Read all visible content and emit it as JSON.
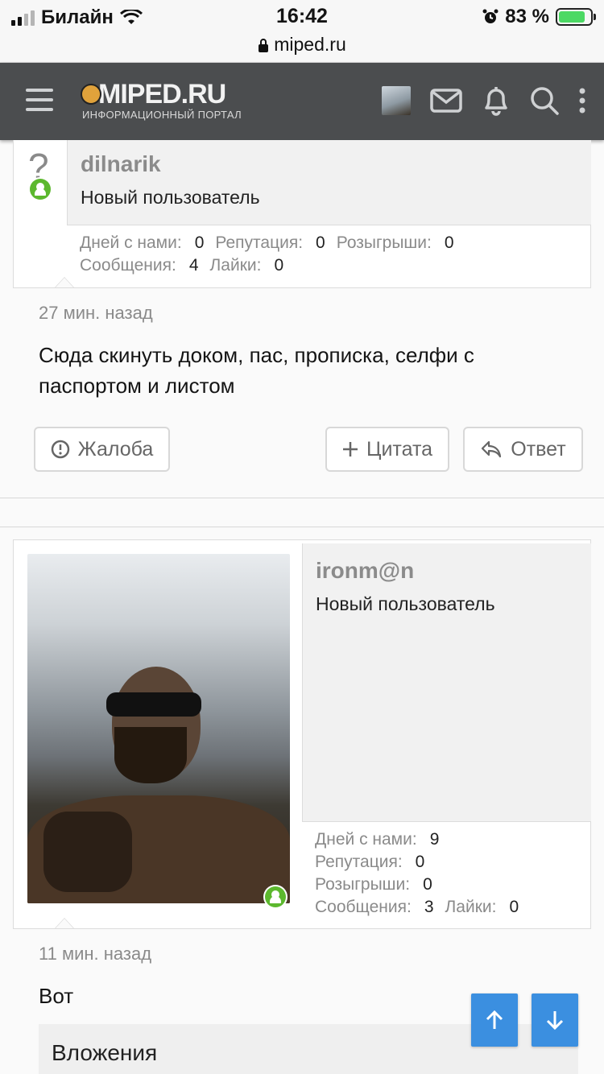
{
  "status_bar": {
    "carrier": "Билайн",
    "time": "16:42",
    "url": "miped.ru",
    "battery": "83 %",
    "battery_level": 0.83
  },
  "header": {
    "logo_title": "MIPED.RU",
    "logo_subtitle": "ИНФОРМАЦИОННЫЙ ПОРТАЛ",
    "icons": [
      "menu-icon",
      "avatar",
      "mail-icon",
      "bell-icon",
      "search-icon",
      "more-vertical-icon"
    ]
  },
  "posts": [
    {
      "username": "dilnarik",
      "user_title": "Новый пользователь",
      "avatar_placeholder": "?",
      "stats": {
        "days_label": "Дней с нами:",
        "days_value": "0",
        "rep_label": "Репутация:",
        "rep_value": "0",
        "raffle_label": "Розыгрыши:",
        "raffle_value": "0",
        "msgs_label": "Сообщения:",
        "msgs_value": "4",
        "likes_label": "Лайки:",
        "likes_value": "0"
      },
      "time": "27 мин. назад",
      "text": "Сюда скинуть доком, пас, прописка, селфи с паспортом и листом",
      "actions": {
        "report": "Жалоба",
        "quote": "Цитата",
        "reply": "Ответ"
      }
    },
    {
      "username": "ironm@n",
      "user_title": "Новый пользователь",
      "stats": {
        "days_label": "Дней с нами:",
        "days_value": "9",
        "rep_label": "Репутация:",
        "rep_value": "0",
        "raffle_label": "Розыгрыши:",
        "raffle_value": "0",
        "msgs_label": "Сообщения:",
        "msgs_value": "3",
        "likes_label": "Лайки:",
        "likes_value": "0"
      },
      "time": "11 мин. назад",
      "text": "Вот",
      "attachments_label": "Вложения"
    }
  ],
  "colors": {
    "header_bg": "#4b4d4f",
    "online": "#5cb82e",
    "nav_button": "#3b8fe0"
  }
}
